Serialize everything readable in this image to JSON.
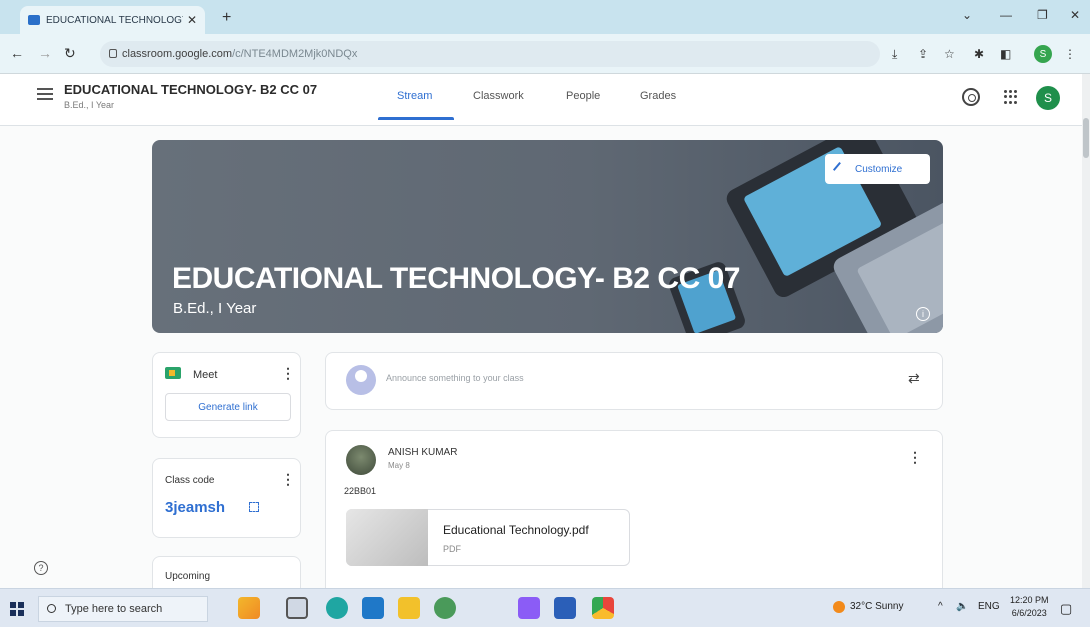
{
  "browser": {
    "tab_title": "EDUCATIONAL TECHNOLOGY- E",
    "url_host": "classroom.google.com",
    "url_path": "/c/NTE4MDM2Mjk0NDQx",
    "profile_initial": "S"
  },
  "header": {
    "class_title": "EDUCATIONAL TECHNOLOGY- B2 CC 07",
    "class_sub": "B.Ed., I Year",
    "tabs": [
      {
        "label": "Stream",
        "active": true
      },
      {
        "label": "Classwork",
        "active": false
      },
      {
        "label": "People",
        "active": false
      },
      {
        "label": "Grades",
        "active": false
      }
    ],
    "user_initial": "S"
  },
  "banner": {
    "title": "EDUCATIONAL TECHNOLOGY- B2 CC 07",
    "subtitle": "B.Ed., I Year",
    "customize_label": "Customize"
  },
  "meet": {
    "label": "Meet",
    "generate_link": "Generate link"
  },
  "class_code": {
    "label": "Class code",
    "code": "3jeamsh"
  },
  "upcoming": {
    "label": "Upcoming"
  },
  "announce": {
    "placeholder": "Announce something to your class"
  },
  "post": {
    "author": "ANISH KUMAR",
    "date": "May 8",
    "text": "22BB01",
    "attachment_name": "Educational Technology.pdf",
    "attachment_type": "PDF"
  },
  "taskbar": {
    "search_placeholder": "Type here to search",
    "weather": "32°C  Sunny",
    "lang": "ENG",
    "time": "12:20 PM",
    "date": "6/6/2023"
  },
  "colors": {
    "accent": "#2f6fd1",
    "avatar_green": "#1f8f4b"
  }
}
